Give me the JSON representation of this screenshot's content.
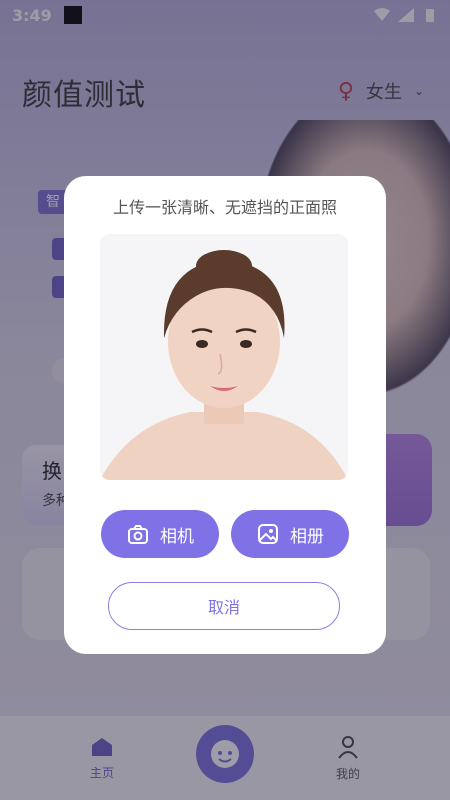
{
  "status_bar": {
    "time": "3:49"
  },
  "header": {
    "title": "颜值测试",
    "gender": "女生"
  },
  "background": {
    "chip_text": "智",
    "card_left_title": "换",
    "card_left_sub": "多种"
  },
  "dialog": {
    "title": "上传一张清晰、无遮挡的正面照",
    "camera_label": "相机",
    "album_label": "相册",
    "cancel_label": "取消"
  },
  "bottom_nav": {
    "home": "主页",
    "mine": "我的"
  },
  "colors": {
    "accent": "#7e72e6",
    "scrim": "rgba(40,36,60,0.45)"
  }
}
